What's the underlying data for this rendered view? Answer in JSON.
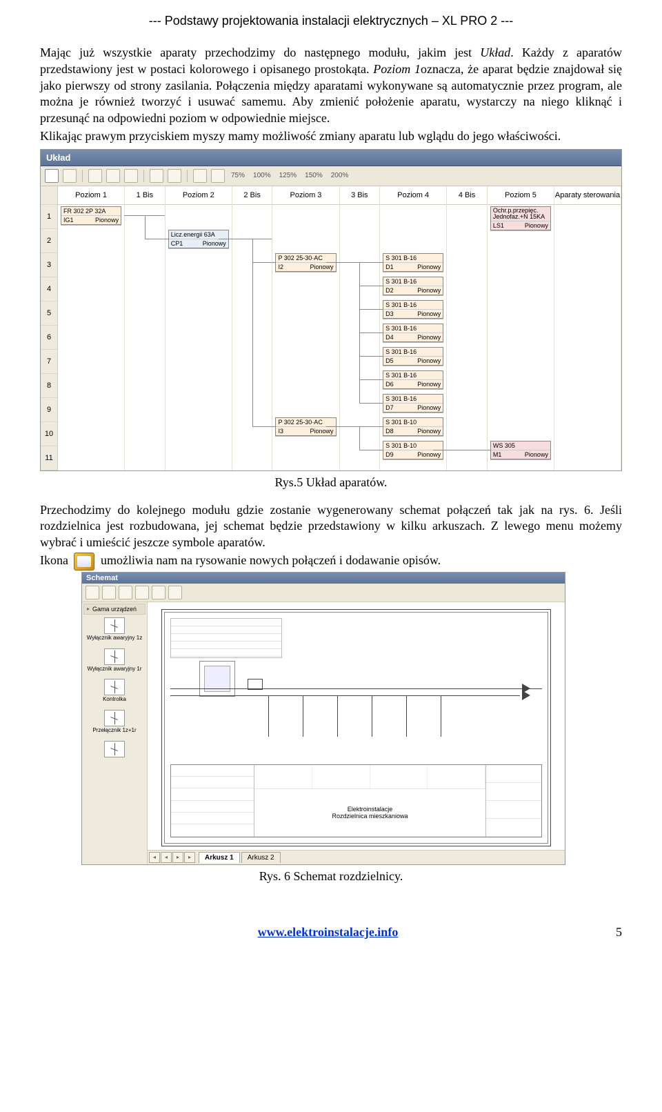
{
  "header": "--- Podstawy projektowania instalacji elektrycznych – XL PRO 2 ---",
  "para1a": "Mając już wszystkie aparaty przechodzimy do następnego modułu, jakim jest ",
  "para1b": "Układ",
  "para1c": ". Każdy z aparatów przedstawiony jest w postaci kolorowego i opisanego prostokąta. ",
  "para1d": "Poziom 1",
  "para1e": "oznacza, że aparat będzie znajdował się jako pierwszy od strony zasilania. Połączenia między aparatami wykonywane są automatycznie przez program, ale można je również tworzyć i usuwać samemu. Aby zmienić położenie aparatu, wystarczy na niego kliknąć i przesunąć na odpowiedni poziom w odpowiednie miejsce.",
  "para2": "Klikając prawym przyciskiem myszy mamy możliwość zmiany aparatu lub wglądu do jego właściwości.",
  "uklad": {
    "title": "Układ",
    "zoom": [
      "75%",
      "100%",
      "125%",
      "150%",
      "200%"
    ],
    "columns": [
      "Poziom 1",
      "1 Bis",
      "Poziom 2",
      "2 Bis",
      "Poziom 3",
      "3 Bis",
      "Poziom 4",
      "4 Bis",
      "Poziom 5",
      "Aparaty sterowania"
    ],
    "rows": [
      "1",
      "2",
      "3",
      "4",
      "5",
      "6",
      "7",
      "8",
      "9",
      "10",
      "11"
    ],
    "blocks": {
      "p1": {
        "t": "FR 302 2P 32A",
        "id": "IG1",
        "dir": "Pionowy"
      },
      "p2": {
        "t": "Licz.energii 63A",
        "id": "CP1",
        "dir": "Pionowy"
      },
      "p3a": {
        "t": "P 302 25-30·AC",
        "id": "I2",
        "dir": "Pionowy"
      },
      "p3b": {
        "t": "P 302 25-30·AC",
        "id": "I3",
        "dir": "Pionowy"
      },
      "p4label": "S 301 B-16",
      "p4ids": [
        "D1",
        "D2",
        "D3",
        "D4",
        "D5",
        "D6",
        "D7",
        "D8",
        "D9"
      ],
      "p4dir": "Pionowy",
      "p4_b10": "S 301 B-10",
      "och": {
        "t": "Ochr.p.przepięc.",
        "sub": "Jednofaz.+N 15KA",
        "id": "LS1",
        "dir": "Pionowy"
      },
      "ws": {
        "t": "WS 305",
        "id": "M1",
        "dir": "Pionowy"
      }
    }
  },
  "caption1": "Rys.5 Układ aparatów.",
  "para3": "Przechodzimy do kolejnego modułu gdzie zostanie wygenerowany schemat połączeń tak jak na  rys. 6. Jeśli rozdzielnica jest rozbudowana, jej schemat będzie przedstawiony w kilku arkuszach. Z lewego menu możemy wybrać i umieścić jeszcze symbole aparatów.",
  "para4a": "Ikona ",
  "para4b": " umożliwia nam na rysowanie nowych połączeń i dodawanie opisów.",
  "schemat": {
    "title": "Schemat",
    "side_header": "Gama urządzeń",
    "side_items": [
      "Wyłącznik awaryjny 1z",
      "Wyłącznik awaryjny 1r",
      "Kontrolka",
      "Przełącznik 1z+1r"
    ],
    "titleblock_line1": "Elektroinstalacje",
    "titleblock_line2": "Rozdzielnica mieszkaniowa",
    "tabs": [
      "Arkusz 1",
      "Arkusz 2"
    ]
  },
  "caption2": "Rys. 6 Schemat rozdzielnicy.",
  "footer_url": "www.elektroinstalacje.info",
  "footer_page": "5"
}
